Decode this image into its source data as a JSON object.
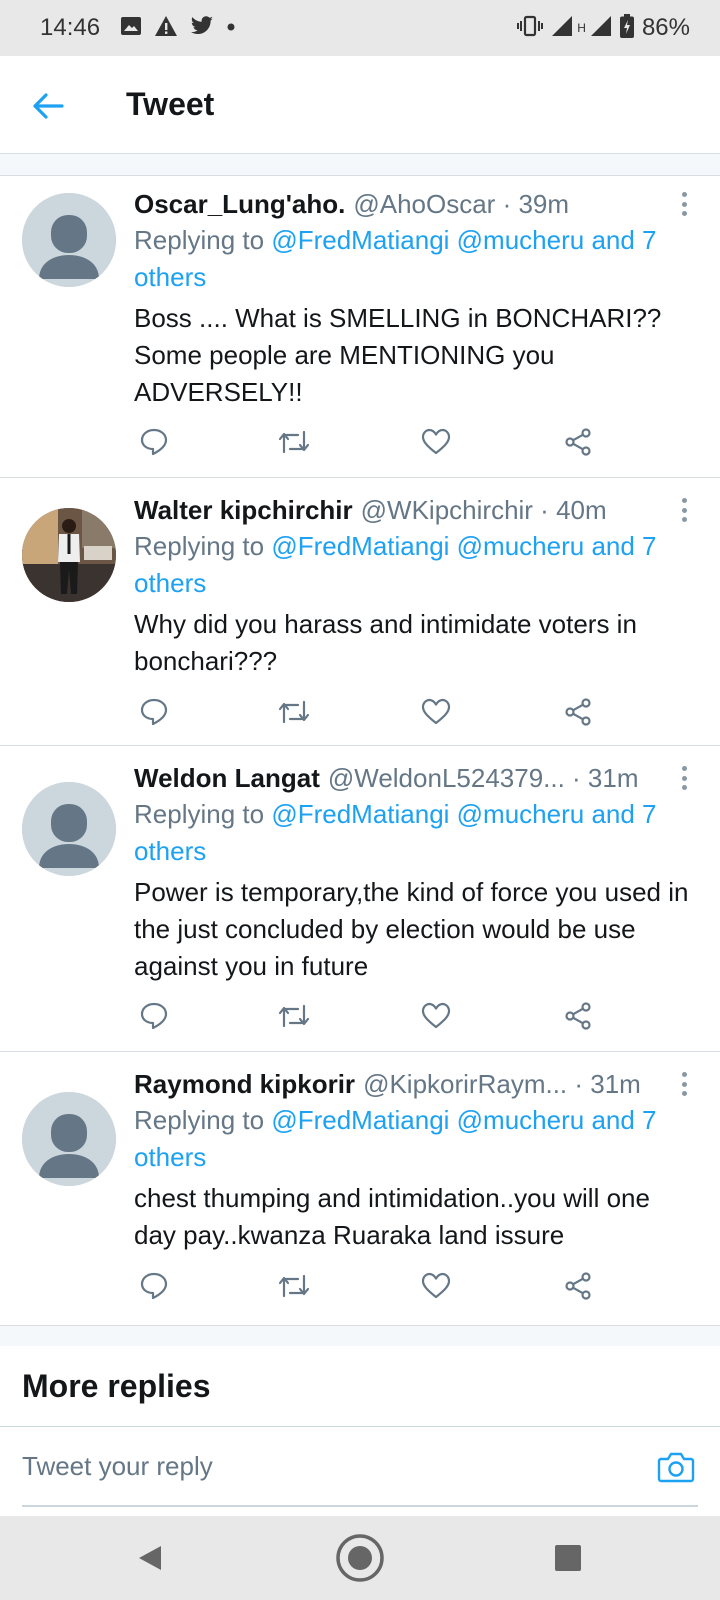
{
  "status_bar": {
    "time": "14:46",
    "battery": "86%",
    "network_label": "H",
    "left_icons": [
      "image-icon",
      "warning-icon",
      "twitter-icon",
      "dot-icon"
    ],
    "right_icons": [
      "vibrate-icon",
      "signal-icon",
      "signal-icon",
      "battery-charging-icon"
    ]
  },
  "header": {
    "title": "Tweet"
  },
  "tweets": [
    {
      "name": "Oscar_Lung'aho.",
      "handle": "@AhoOscar · 39m",
      "replying_prefix": "Replying to ",
      "replying_mentions": "@FredMatiangi @mucheru and 7 others",
      "text": "Boss .... What is SMELLING in BONCHARI?? Some people are MENTIONING you ADVERSELY!!",
      "avatar": "default"
    },
    {
      "name": "Walter kipchirchir",
      "handle": "@WKipchirchir · 40m",
      "replying_prefix": "Replying to ",
      "replying_mentions": "@FredMatiangi @mucheru and 7 others",
      "text": "Why did you harass and intimidate voters in bonchari???",
      "avatar": "photo"
    },
    {
      "name": "Weldon Langat",
      "handle": "@WeldonL524379... · 31m",
      "replying_prefix": "Replying to ",
      "replying_mentions": "@FredMatiangi @mucheru and 7 others",
      "text": "Power is temporary,the kind of force you used in the just concluded by election would be use against you in future",
      "avatar": "default"
    },
    {
      "name": "Raymond kipkorir",
      "handle": "@KipkorirRaym... · 31m",
      "replying_prefix": "Replying to ",
      "replying_mentions": "@FredMatiangi @mucheru and 7 others",
      "text": "chest thumping and intimidation..you will one day pay..kwanza Ruaraka land issure",
      "avatar": "default"
    }
  ],
  "more_replies": "More replies",
  "reply_bar": {
    "placeholder": "Tweet your reply"
  },
  "colors": {
    "accent": "#1da1f2",
    "text": "#14171a",
    "secondary": "#657786",
    "divider": "#d7dde2"
  }
}
